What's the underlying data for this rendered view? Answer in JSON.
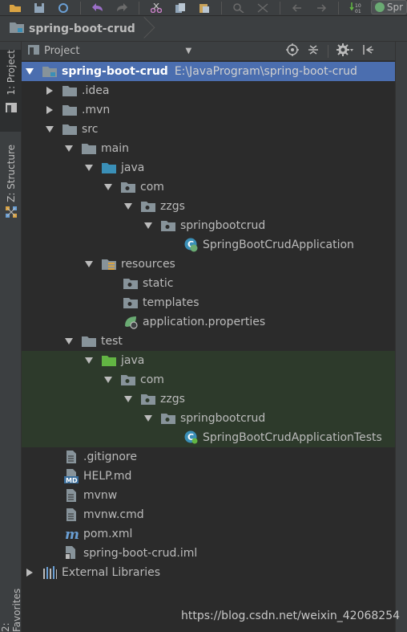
{
  "run_config": {
    "label": "Spr"
  },
  "navbar": {
    "crumb": "spring-boot-crud"
  },
  "left_tools": [
    {
      "label": "1: Project"
    },
    {
      "label": "Z: Structure"
    },
    {
      "label": "2: Favorites"
    }
  ],
  "panel": {
    "title": "Project"
  },
  "tree": [
    {
      "label": "spring-boot-crud",
      "path": "E:\\JavaProgram\\spring-boot-crud",
      "icon": "module-folder-icon"
    },
    {
      "label": ".idea",
      "icon": "folder-icon"
    },
    {
      "label": ".mvn",
      "icon": "folder-icon"
    },
    {
      "label": "src",
      "icon": "folder-icon"
    },
    {
      "label": "main",
      "icon": "folder-icon"
    },
    {
      "label": "java",
      "icon": "source-root-icon"
    },
    {
      "label": "com",
      "icon": "package-icon"
    },
    {
      "label": "zzgs",
      "icon": "package-icon"
    },
    {
      "label": "springbootcrud",
      "icon": "package-icon"
    },
    {
      "label": "SpringBootCrudApplication",
      "icon": "spring-boot-class-icon"
    },
    {
      "label": "resources",
      "icon": "resources-root-icon"
    },
    {
      "label": "static",
      "icon": "package-icon"
    },
    {
      "label": "templates",
      "icon": "package-icon"
    },
    {
      "label": "application.properties",
      "icon": "spring-properties-icon"
    },
    {
      "label": "test",
      "icon": "folder-icon"
    },
    {
      "label": "java",
      "icon": "test-root-icon"
    },
    {
      "label": "com",
      "icon": "package-icon"
    },
    {
      "label": "zzgs",
      "icon": "package-icon"
    },
    {
      "label": "springbootcrud",
      "icon": "package-icon"
    },
    {
      "label": "SpringBootCrudApplicationTests",
      "icon": "test-class-icon"
    },
    {
      "label": ".gitignore",
      "icon": "text-file-icon"
    },
    {
      "label": "HELP.md",
      "icon": "markdown-file-icon"
    },
    {
      "label": "mvnw",
      "icon": "text-file-icon"
    },
    {
      "label": "mvnw.cmd",
      "icon": "text-file-icon"
    },
    {
      "label": "pom.xml",
      "icon": "maven-icon"
    },
    {
      "label": "spring-boot-crud.iml",
      "icon": "iml-file-icon"
    },
    {
      "label": "External Libraries",
      "icon": "libraries-icon"
    }
  ],
  "watermark": "https://blog.csdn.net/weixin_42068254",
  "colors": {
    "selection": "#4b6eaf",
    "test_bg": "#2d3a2b",
    "folder": "#87939a",
    "source": "#3a8fb7",
    "test_source": "#62b543",
    "spring": "#6aab73"
  }
}
